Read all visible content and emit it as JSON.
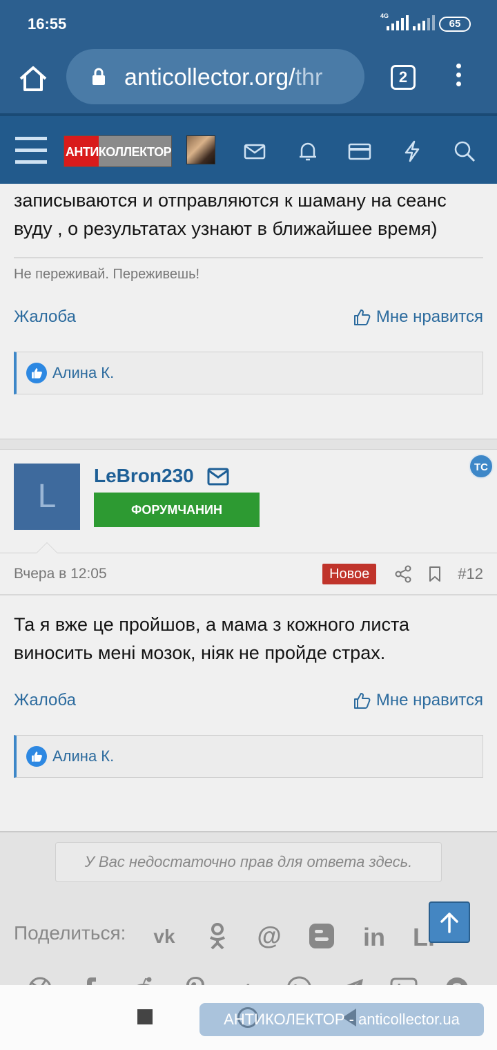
{
  "status_bar": {
    "time": "16:55",
    "network": "4G",
    "battery": "65"
  },
  "browser": {
    "url_main": "anticollector.org/",
    "url_dim": "thr",
    "tab_count": "2"
  },
  "site": {
    "logo_text": "АНТИКОЛЛЕКТОР"
  },
  "post_prev": {
    "text": "записываются и отправляются к шаману на сеанс вуду , о результатах узнают в ближайшее время)",
    "signature": "Не переживай. Переживешь!",
    "report_label": "Жалоба",
    "like_label": "Мне нравится",
    "reactions": "Алина К."
  },
  "post": {
    "username": "LeBron230",
    "avatar_letter": "L",
    "rank": "ФОРУМЧАНИН",
    "badge": "TC",
    "date": "Вчера в 12:05",
    "new_label": "Новое",
    "post_number": "#12",
    "text": "Та я вже це пройшов, а мама з кожного листа виносить мені мозок, ніяк не пройде страх.",
    "report_label": "Жалоба",
    "like_label": "Мне нравится",
    "reactions": "Алина К."
  },
  "no_permission": "У Вас недостаточно прав для ответа здесь.",
  "share": {
    "label": "Поделиться:",
    "row1": [
      "vk-icon",
      "odnoklassniki-icon",
      "email-icon",
      "blogger-icon",
      "linkedin-icon",
      "livejournal-icon"
    ],
    "row2": [
      "xing-icon",
      "facebook-icon",
      "reddit-icon",
      "pinterest-icon",
      "tumblr-icon",
      "whatsapp-icon",
      "telegram-icon",
      "viber-icon",
      "skype-icon"
    ]
  },
  "watermark": "АНТИКОЛЕКТОР - anticollector.ua",
  "colors": {
    "header": "#2c5f8f",
    "nav": "#225a8c",
    "accent": "#2c6b9e",
    "rank": "#2d9a32",
    "new_badge": "#c0342b"
  }
}
